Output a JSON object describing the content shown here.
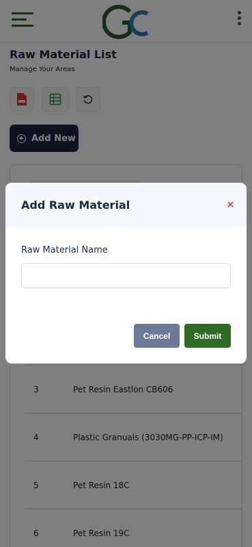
{
  "colors": {
    "brand_green": "#2e5a2b",
    "brand_blue": "#2f7fb5",
    "navy": "#1a2340",
    "submit_green": "#2e6b23",
    "cancel_gray": "#6c7a97",
    "close_red": "#e53935"
  },
  "header": {
    "menu_icon": "hamburger-menu-icon",
    "logo_icon": "gc-logo-icon",
    "more_icon": "vertical-dots-icon"
  },
  "page": {
    "title": "Raw Material List",
    "subtitle": "Manage Your Areas"
  },
  "toolbar": {
    "pdf_icon": "pdf-file-icon",
    "excel_icon": "spreadsheet-icon",
    "refresh_icon": "refresh-icon",
    "add_label": "Add New",
    "add_icon": "plus-circle-icon"
  },
  "table": {
    "rows": [
      {
        "num": "3",
        "name": "Pet Resin Eastlon CB606"
      },
      {
        "num": "4",
        "name": "Plastic Granuals (3030MG-PP-ICP-IM)"
      },
      {
        "num": "5",
        "name": "Pet Resin 18C"
      },
      {
        "num": "6",
        "name": "Pet Resin 19C"
      }
    ]
  },
  "modal": {
    "title": "Add Raw Material",
    "close_icon": "close-icon",
    "field_label": "Raw Material Name",
    "field_value": "",
    "cancel_label": "Cancel",
    "submit_label": "Submit"
  }
}
